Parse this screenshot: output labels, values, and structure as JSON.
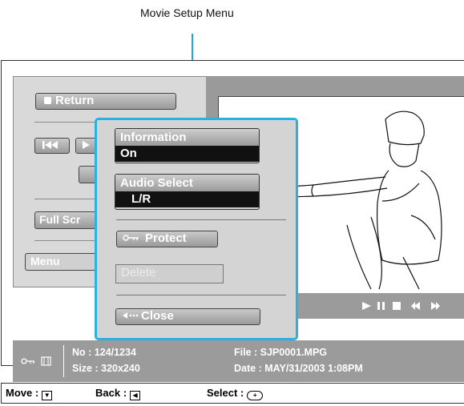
{
  "callout": {
    "title": "Movie Setup Menu"
  },
  "left_panel": {
    "return_label": "Return",
    "full_screen_label": "Full Scr",
    "menu_label": "Menu"
  },
  "movie_setup_menu": {
    "information": {
      "label": "Information",
      "value": "On"
    },
    "audio_select": {
      "label": "Audio Select",
      "value": "L/R"
    },
    "protect_label": "Protect",
    "delete_label": "Delete",
    "close_label": "Close"
  },
  "file_info": {
    "no": "No   : 124/1234",
    "size": "Size : 320x240",
    "file": "File  : SJP0001.MPG",
    "date": "Date : MAY/31/2003 1:08PM"
  },
  "nav": {
    "move": "Move :",
    "back": "Back :",
    "select": "Select :"
  },
  "colors": {
    "menu_border": "#2bb1e0",
    "panel_gray": "#9b9b9b",
    "value_bg": "#111111"
  }
}
